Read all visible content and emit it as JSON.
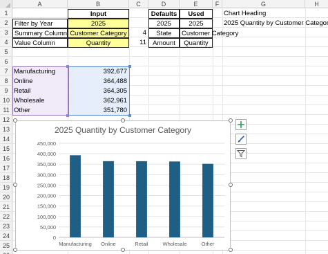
{
  "columns": [
    "A",
    "B",
    "C",
    "D",
    "E",
    "F",
    "G",
    "H"
  ],
  "rows": [
    "1",
    "2",
    "3",
    "4",
    "5",
    "6",
    "7",
    "8",
    "9",
    "10",
    "11",
    "12",
    "13",
    "14",
    "15",
    "16",
    "17",
    "18",
    "19",
    "20",
    "21",
    "22",
    "23",
    "24",
    "25",
    "26"
  ],
  "header_row": {
    "input_label": "Input",
    "defaults_label": "Defaults",
    "used_label": "Used",
    "chart_heading_label": "Chart Heading"
  },
  "row2": {
    "label": "Filter by Year",
    "input": "2025",
    "default": "2025",
    "used": "2025",
    "chart_heading_value": "2025 Quantity by Customer Category"
  },
  "row3": {
    "label": "Summary Column",
    "input": "Customer Category",
    "index": "4",
    "default": "State",
    "used": "Customer Category"
  },
  "row4": {
    "label": "Value Column",
    "input": "Quantity",
    "index": "11",
    "default": "Amount",
    "used": "Quantity"
  },
  "summary_table": [
    {
      "category": "Manufacturing",
      "value": "392,677"
    },
    {
      "category": "Online",
      "value": "364,488"
    },
    {
      "category": "Retail",
      "value": "364,305"
    },
    {
      "category": "Wholesale",
      "value": "362,961"
    },
    {
      "category": "Other",
      "value": "351,780"
    }
  ],
  "side_buttons": {
    "elements": "chart-elements-plus-icon",
    "styles": "chart-styles-brush-icon",
    "filters": "chart-filters-funnel-icon"
  },
  "colors": {
    "bar": "#1f5f86",
    "input_fill": "#ffff99",
    "purple_highlight": "#9e7cc1",
    "blue_highlight": "#5b8fd1",
    "plus_green": "#2e9b4f"
  },
  "chart_data": {
    "type": "bar",
    "title": "2025 Quantity by Customer Category",
    "categories": [
      "Manufacturing",
      "Online",
      "Retail",
      "Wholesale",
      "Other"
    ],
    "values": [
      392677,
      364488,
      364305,
      362961,
      351780
    ],
    "ylim": [
      0,
      450000
    ],
    "yticks": [
      0,
      50000,
      100000,
      150000,
      200000,
      250000,
      300000,
      350000,
      400000,
      450000
    ],
    "ytick_labels": [
      "0",
      "50,000",
      "100,000",
      "150,000",
      "200,000",
      "250,000",
      "300,000",
      "350,000",
      "400,000",
      "450,000"
    ],
    "xlabel": "",
    "ylabel": "",
    "grid": true,
    "legend": "none"
  }
}
